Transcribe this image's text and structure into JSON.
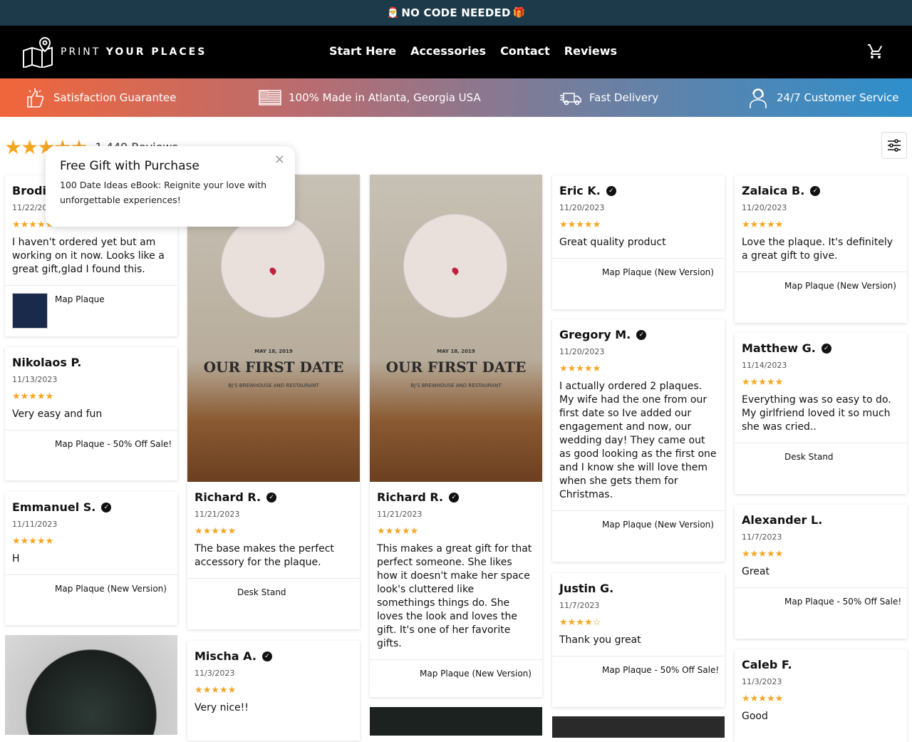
{
  "announcement": {
    "left_emoji": "🎅",
    "text": "NO CODE NEEDED",
    "right_emoji": "🎁"
  },
  "header": {
    "brand_light": "PRINT",
    "brand_bold": "YOUR PLACES",
    "nav": [
      "Start Here",
      "Accessories",
      "Contact",
      "Reviews"
    ]
  },
  "trust_bar": [
    "Satisfaction Guarantee",
    "100% Made in Atlanta, Georgia USA",
    "Fast Delivery",
    "24/7 Customer Service"
  ],
  "reviews_summary": {
    "stars": "★★★★★",
    "count_label": "1,449 Reviews"
  },
  "popup": {
    "title": "Free Gift with Purchase",
    "body": "100 Date Ideas eBook: Reignite your love with unforgettable experiences!",
    "close": "×"
  },
  "photo_text": {
    "date": "MAY 18, 2019",
    "title": "OUR FIRST DATE",
    "venue": "BJ'S BREWHOUSE AND RESTAURANT"
  },
  "reviews": [
    {
      "name": "Brodie",
      "date": "11/22/2023",
      "stars": "★★★★★",
      "text": "I haven't ordered yet but am working on it now. Looks like a great gift,glad I found this.",
      "product": "Map Plaque",
      "verified": false
    },
    {
      "name": "Nikolaos P.",
      "date": "11/13/2023",
      "stars": "★★★★★",
      "text": "Very easy and fun",
      "product": "Map Plaque - 50% Off Sale!",
      "verified": false
    },
    {
      "name": "Emmanuel S.",
      "date": "11/11/2023",
      "stars": "★★★★★",
      "text": "H",
      "product": "Map Plaque (New Version)",
      "verified": true
    },
    {
      "name": "Richard R.",
      "date": "11/21/2023",
      "stars": "★★★★★",
      "text": "The base makes the perfect accessory for the plaque.",
      "product": "Desk Stand",
      "verified": true
    },
    {
      "name": "Mischa A.",
      "date": "11/3/2023",
      "stars": "★★★★★",
      "text": "Very nice!!",
      "product": "",
      "verified": true
    },
    {
      "name": "Richard R.",
      "date": "11/21/2023",
      "stars": "★★★★★",
      "text": "This makes a great gift for that perfect someone. She likes how it doesn't make her space look's cluttered like somethings things do. She loves the look and loves the gift. It's one of her favorite gifts.",
      "product": "Map Plaque (New Version)",
      "verified": true
    },
    {
      "name": "Eric K.",
      "date": "11/20/2023",
      "stars": "★★★★★",
      "text": "Great quality product",
      "product": "Map Plaque (New Version)",
      "verified": true
    },
    {
      "name": "Gregory M.",
      "date": "11/20/2023",
      "stars": "★★★★★",
      "text": "I actually ordered 2 plaques. My wife had the one from our first date so Ive added our engagement and now, our wedding day! They came out as good looking as the first one and I know she will love them when she gets them for Christmas.",
      "product": "Map Plaque (New Version)",
      "verified": true
    },
    {
      "name": "Justin G.",
      "date": "11/7/2023",
      "stars": "★★★★☆",
      "text": "Thank you great",
      "product": "Map Plaque - 50% Off Sale!",
      "verified": false
    },
    {
      "name": "Zalaica B.",
      "date": "11/20/2023",
      "stars": "★★★★★",
      "text": "Love the plaque. It's definitely a great gift to give.",
      "product": "Map Plaque (New Version)",
      "verified": true
    },
    {
      "name": "Matthew G.",
      "date": "11/14/2023",
      "stars": "★★★★★",
      "text": "Everything was so easy to do. My girlfriend loved it so much she was cried..",
      "product": "Desk Stand",
      "verified": true
    },
    {
      "name": "Alexander L.",
      "date": "11/7/2023",
      "stars": "★★★★★",
      "text": "Great",
      "product": "Map Plaque - 50% Off Sale!",
      "verified": false
    },
    {
      "name": "Caleb F.",
      "date": "11/3/2023",
      "stars": "★★★★★",
      "text": "Good",
      "product": "",
      "verified": false
    }
  ],
  "colors": {
    "announce_bg": "#1c3a4a",
    "star": "#f5a623",
    "header_bg": "#000000"
  }
}
